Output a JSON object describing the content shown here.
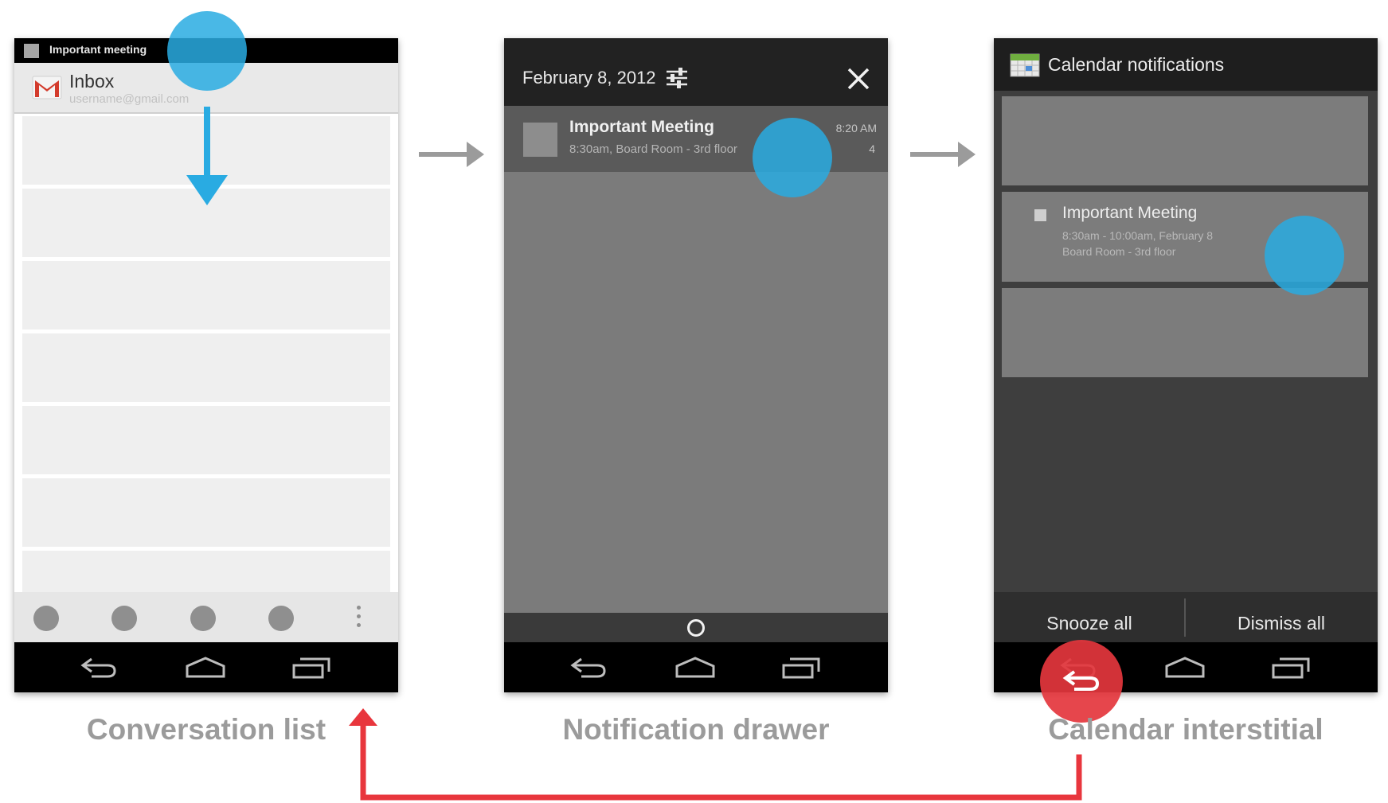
{
  "colors": {
    "touch": "#29abe2",
    "flow_arrow": "#9b9b9b",
    "return_arrow": "#e8363d",
    "caption": "#9b9b9b"
  },
  "phone1": {
    "status_text": "Important meeting",
    "inbox_label": "Inbox",
    "account": "username@gmail.com",
    "icons": [
      "gmail-icon",
      "overflow-menu-icon"
    ]
  },
  "phone2": {
    "date": "February 8, 2012",
    "notification": {
      "title": "Important Meeting",
      "subtitle": "8:30am, Board Room - 3rd floor",
      "time": "8:20 AM",
      "count": "4"
    },
    "icons": [
      "settings-sliders-icon",
      "close-icon"
    ]
  },
  "phone3": {
    "title": "Calendar notifications",
    "card": {
      "title": "Important Meeting",
      "line1": "8:30am - 10:00am, February 8",
      "line2": "Board Room - 3rd floor"
    },
    "snooze_label": "Snooze all",
    "dismiss_label": "Dismiss all"
  },
  "captions": {
    "phone1": "Conversation list",
    "phone2": "Notification drawer",
    "phone3": "Calendar interstitial"
  },
  "nav_icons": [
    "back-icon",
    "home-icon",
    "recents-icon"
  ]
}
